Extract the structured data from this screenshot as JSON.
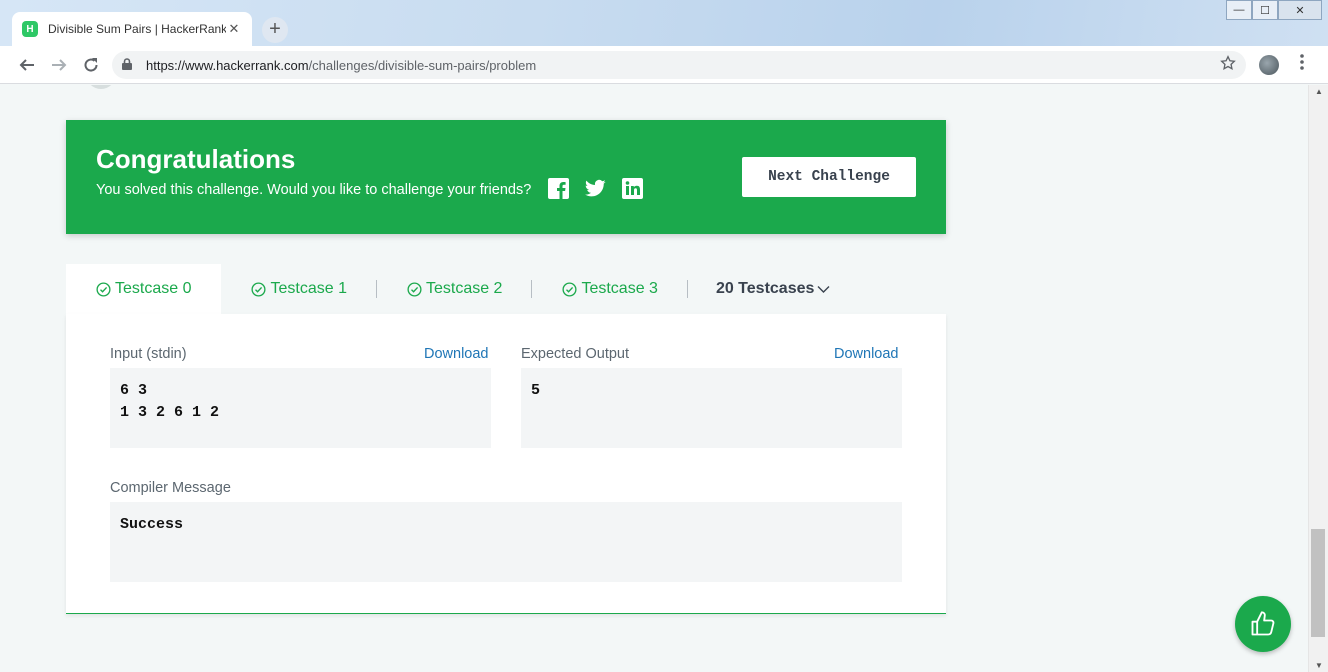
{
  "browser": {
    "tab_title": "Divisible Sum Pairs | HackerRank",
    "tab_close": "✕",
    "new_tab": "+",
    "url_host": "https://www.hackerrank.com",
    "url_path": "/challenges/divisible-sum-pairs/problem",
    "favicon_letter": "H",
    "win_min": "—",
    "win_max": "☐",
    "win_close": "✕"
  },
  "banner": {
    "title": "Congratulations",
    "subtitle": "You solved this challenge. Would you like to challenge your friends?",
    "next_button": "Next Challenge",
    "social": [
      "facebook-icon",
      "twitter-icon",
      "linkedin-icon"
    ]
  },
  "testcases": {
    "tabs": [
      {
        "label": "Testcase 0",
        "active": true
      },
      {
        "label": "Testcase 1",
        "active": false
      },
      {
        "label": "Testcase 2",
        "active": false
      },
      {
        "label": "Testcase 3",
        "active": false
      }
    ],
    "more": "20 Testcases"
  },
  "result": {
    "input_label": "Input (stdin)",
    "input_download": "Download",
    "input_value": "6 3\n1 3 2 6 1 2",
    "expected_label": "Expected Output",
    "expected_download": "Download",
    "expected_value": "5",
    "compiler_label": "Compiler Message",
    "compiler_value": "Success"
  },
  "colors": {
    "accent": "#1ba94c",
    "link": "#1f76b6"
  }
}
